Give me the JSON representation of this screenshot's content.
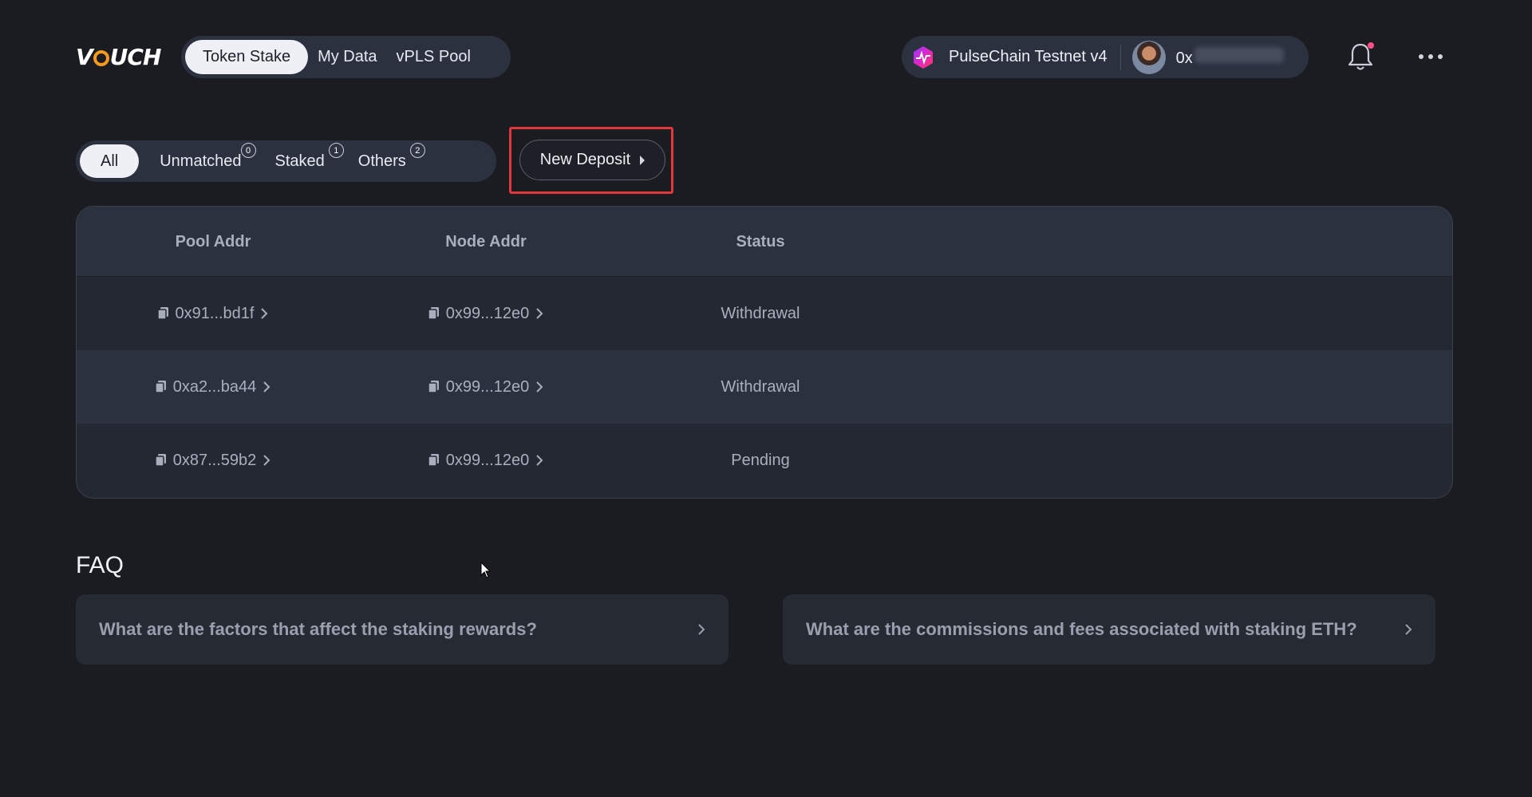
{
  "header": {
    "logo": "VOUCH",
    "tabs": [
      {
        "label": "Token Stake",
        "active": true
      },
      {
        "label": "My Data",
        "active": false
      },
      {
        "label": "vPLS Pool",
        "active": false
      }
    ],
    "network": "PulseChain Testnet v4",
    "account_prefix": "0x"
  },
  "filters": {
    "tabs": [
      {
        "label": "All",
        "active": true
      },
      {
        "label": "Unmatched",
        "count": "0"
      },
      {
        "label": "Staked",
        "count": "1"
      },
      {
        "label": "Others",
        "count": "2"
      }
    ],
    "new_deposit_label": "New Deposit"
  },
  "table": {
    "columns": [
      "Pool Addr",
      "Node Addr",
      "Status"
    ],
    "rows": [
      {
        "pool": "0x91...bd1f",
        "node": "0x99...12e0",
        "status": "Withdrawal"
      },
      {
        "pool": "0xa2...ba44",
        "node": "0x99...12e0",
        "status": "Withdrawal"
      },
      {
        "pool": "0x87...59b2",
        "node": "0x99...12e0",
        "status": "Pending"
      }
    ]
  },
  "faq": {
    "title": "FAQ",
    "items": [
      {
        "question": "What are the factors that affect the staking rewards?"
      },
      {
        "question": "What are the commissions and fees associated with staking ETH?"
      }
    ]
  },
  "colors": {
    "background": "#1b1c21",
    "pill": "#2c3140",
    "active_tab": "#eef0f5",
    "highlight_border": "#e2373a",
    "notification_dot": "#ff4f84"
  },
  "icons": [
    "chain-logo-icon",
    "avatar",
    "bell-icon",
    "more-icon",
    "copy-icon",
    "chevron-right-icon",
    "caret-right-icon",
    "cursor-icon"
  ]
}
